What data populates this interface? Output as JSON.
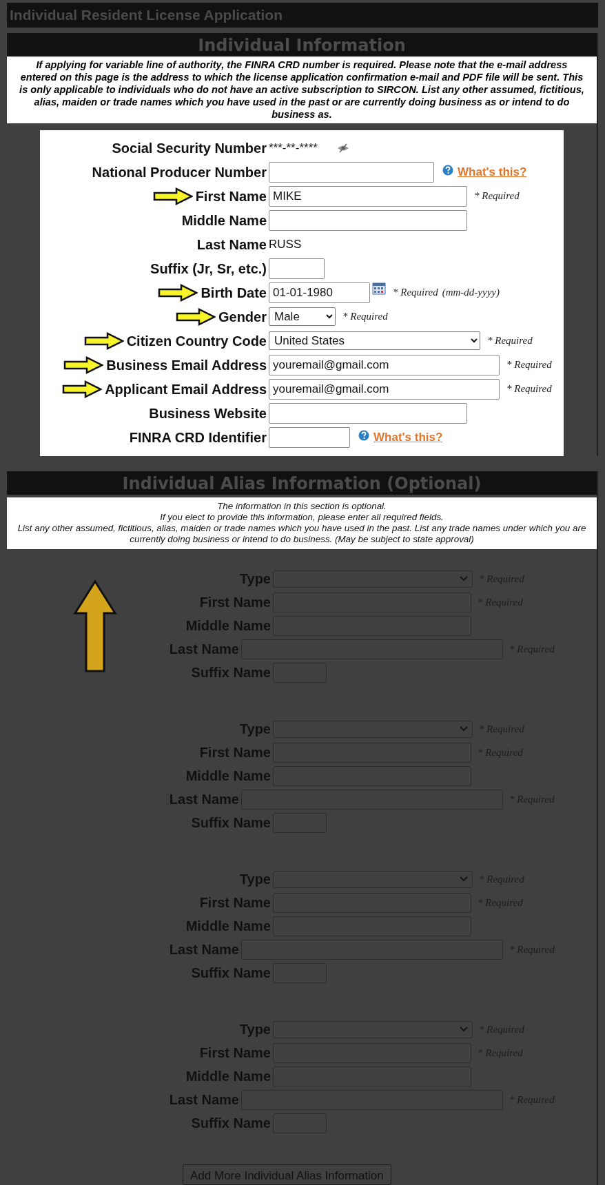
{
  "title": "Individual Resident License Application",
  "individual_info": {
    "heading": "Individual Information",
    "notice": "If applying for variable line of authority, the FINRA CRD number is required. Please note that the e-mail address entered on this page is the address to which the license application confirmation e-mail and PDF file will be sent. This is only applicable to individuals who do not have an active subscription to SIRCON. List any other assumed, fictitious, alias, maiden or trade names which you have used in the past or are currently doing business as or intend to do business as.",
    "fields": [
      {
        "kind": "masked",
        "label": "Social Security Number",
        "value": "***-**-****",
        "highlighted": false
      },
      {
        "kind": "input",
        "label": "National Producer Number",
        "highlighted": false,
        "help": "What's this?"
      },
      {
        "kind": "input",
        "label": "First Name",
        "value": "MIKE",
        "highlighted": true,
        "required": "* Required"
      },
      {
        "kind": "input",
        "label": "Middle Name",
        "highlighted": false
      },
      {
        "kind": "static",
        "label": "Last Name",
        "value": "RUSS",
        "highlighted": false
      },
      {
        "kind": "input",
        "label": "Suffix (Jr, Sr, etc.)",
        "highlighted": false
      },
      {
        "kind": "date",
        "label": "Birth Date",
        "value": "01-01-1980",
        "highlighted": true,
        "required": "* Required",
        "hint": "(mm-dd-yyyy)"
      },
      {
        "kind": "select",
        "label": "Gender",
        "value": "Male",
        "highlighted": true,
        "required": "* Required"
      },
      {
        "kind": "select",
        "label": "Citizen Country Code",
        "value": "United States",
        "highlighted": true,
        "required": "* Required"
      },
      {
        "kind": "input",
        "label": "Business Email Address",
        "value": "youremail@gmail.com",
        "highlighted": true,
        "required": "* Required"
      },
      {
        "kind": "input",
        "label": "Applicant Email Address",
        "value": "youremail@gmail.com",
        "highlighted": true,
        "required": "* Required"
      },
      {
        "kind": "input",
        "label": "Business Website",
        "highlighted": false
      },
      {
        "kind": "input",
        "label": "FINRA CRD Identifier",
        "highlighted": false,
        "help": "What's this?"
      }
    ]
  },
  "alias_info": {
    "heading": "Individual Alias Information (Optional)",
    "notice_lines": [
      "The information in this section is optional.",
      "If you elect to provide this information, please enter all required fields.",
      "List any other assumed, fictitious, alias, maiden or trade names which you have used in the past. List any trade names under which you are currently doing business or intend to do business. (May be subject to state approval)"
    ],
    "entries": [
      {
        "fields": [
          {
            "kind": "select",
            "label": "Type",
            "required": "* Required"
          },
          {
            "kind": "input",
            "label": "First Name",
            "required": "* Required"
          },
          {
            "kind": "input",
            "label": "Middle Name"
          },
          {
            "kind": "input",
            "label": "Last Name",
            "required": "* Required"
          },
          {
            "kind": "input",
            "label": "Suffix Name"
          }
        ]
      },
      {
        "fields": [
          {
            "kind": "select",
            "label": "Type",
            "required": "* Required"
          },
          {
            "kind": "input",
            "label": "First Name",
            "required": "* Required"
          },
          {
            "kind": "input",
            "label": "Middle Name"
          },
          {
            "kind": "input",
            "label": "Last Name",
            "required": "* Required"
          },
          {
            "kind": "input",
            "label": "Suffix Name"
          }
        ]
      },
      {
        "fields": [
          {
            "kind": "select",
            "label": "Type",
            "required": "* Required"
          },
          {
            "kind": "input",
            "label": "First Name",
            "required": "* Required"
          },
          {
            "kind": "input",
            "label": "Middle Name"
          },
          {
            "kind": "input",
            "label": "Last Name",
            "required": "* Required"
          },
          {
            "kind": "input",
            "label": "Suffix Name"
          }
        ]
      },
      {
        "fields": [
          {
            "kind": "select",
            "label": "Type",
            "required": "* Required"
          },
          {
            "kind": "input",
            "label": "First Name",
            "required": "* Required"
          },
          {
            "kind": "input",
            "label": "Middle Name"
          },
          {
            "kind": "input",
            "label": "Last Name",
            "required": "* Required"
          },
          {
            "kind": "input",
            "label": "Suffix Name"
          }
        ]
      }
    ],
    "add_button": "Add More Individual Alias Information"
  }
}
